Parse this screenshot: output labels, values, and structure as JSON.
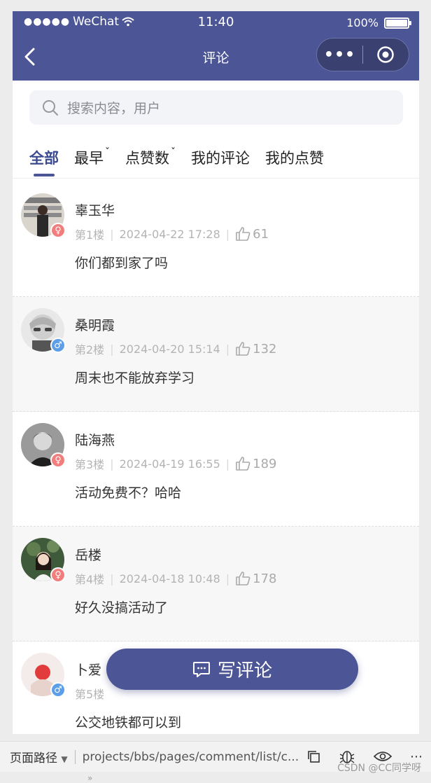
{
  "statusbar": {
    "carrier": "WeChat",
    "time": "11:40",
    "battery": "100%"
  },
  "navbar": {
    "title": "评论",
    "more_label": "•••"
  },
  "search": {
    "placeholder": "搜索内容，用户"
  },
  "tabs": [
    {
      "label": "全部",
      "active": true
    },
    {
      "label": "最早",
      "caret": true
    },
    {
      "label": "点赞数",
      "caret": true
    },
    {
      "label": "我的评论"
    },
    {
      "label": "我的点赞"
    }
  ],
  "comments": [
    {
      "name": "辜玉华",
      "floor": "第1楼",
      "time": "2024-04-22 17:28",
      "likes": "61",
      "content": "你们都到家了吗",
      "gender": "female"
    },
    {
      "name": "桑明霞",
      "floor": "第2楼",
      "time": "2024-04-20 15:14",
      "likes": "132",
      "content": "周末也不能放弃学习",
      "gender": "male"
    },
    {
      "name": "陆海燕",
      "floor": "第3楼",
      "time": "2024-04-19 16:55",
      "likes": "189",
      "content": "活动免费不？哈哈",
      "gender": "female"
    },
    {
      "name": "岳楼",
      "floor": "第4楼",
      "time": "2024-04-18 10:48",
      "likes": "178",
      "content": "好久没搞活动了",
      "gender": "female"
    },
    {
      "name": "卜爱",
      "floor": "第5楼",
      "time": "",
      "likes": "",
      "content": "公交地铁都可以到",
      "gender": "male"
    }
  ],
  "fab": {
    "label": "写评论"
  },
  "devbar": {
    "path_label": "页面路径",
    "path": "projects/bbs/pages/comment/list/c..."
  },
  "watermark": "CSDN @CC同学呀",
  "colors": {
    "primary": "#4c5595",
    "female": "#f27d7d",
    "male": "#5d9ee9"
  }
}
